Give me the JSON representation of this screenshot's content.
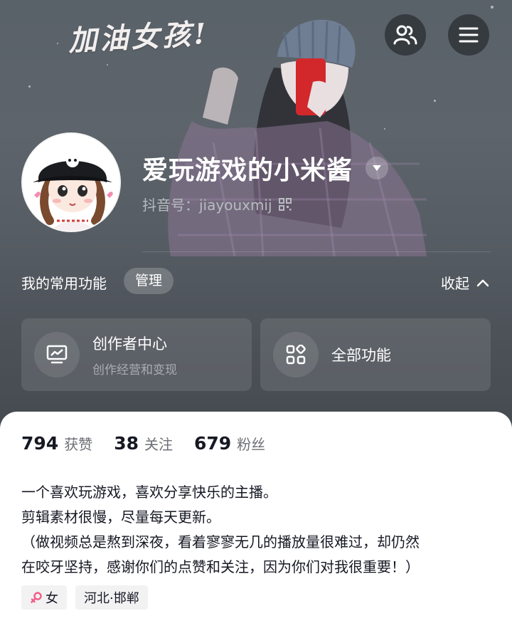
{
  "cover": {
    "slogan": "加油女孩!"
  },
  "header_buttons": {
    "friends_icon": "friends-icon",
    "menu_icon": "hamburger-menu-icon"
  },
  "profile": {
    "nickname": "爱玩游戏的小米酱",
    "id_text": "抖音号：jiayouxmij"
  },
  "functions": {
    "title": "我的常用功能",
    "manage_label": "管理",
    "collapse_label": "收起",
    "cards": [
      {
        "title": "创作者中心",
        "subtitle": "创作经营和变现",
        "icon": "creator-chart-icon"
      },
      {
        "title": "全部功能",
        "subtitle": "",
        "icon": "all-functions-grid-icon"
      }
    ]
  },
  "stats": [
    {
      "value": "794",
      "label": "获赞"
    },
    {
      "value": "38",
      "label": "关注"
    },
    {
      "value": "679",
      "label": "粉丝"
    }
  ],
  "bio": [
    "一个喜欢玩游戏，喜欢分享快乐的主播。",
    "剪辑素材很慢，尽量每天更新。",
    "（做视频总是熬到深夜，看着寥寥无几的播放量很难过，却仍然",
    "在咬牙坚持，感谢你们的点赞和关注，因为你们对我很重要！）"
  ],
  "tags": {
    "gender": "女",
    "location": "河北·邯郸"
  },
  "colors": {
    "gender_icon": "#f25b85",
    "text_primary": "#161823",
    "text_secondary": "#6d6f75"
  }
}
